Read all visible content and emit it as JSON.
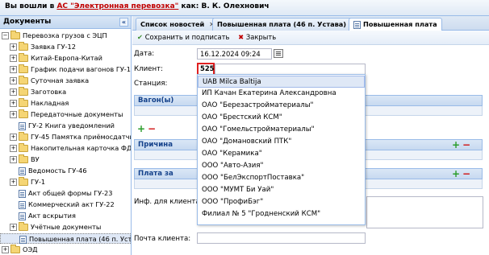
{
  "header": {
    "logged_prefix": "Вы вошли в",
    "system_name": "АС \"Электронная перевозка\"",
    "as_text": "как: В. К. Олехнович"
  },
  "sidebar": {
    "title": "Документы",
    "collapse": "«",
    "items": [
      {
        "label": "Перевозка грузов с ЭЦП"
      },
      {
        "label": "Заявка ГУ-12"
      },
      {
        "label": "Китай-Европа-Китай"
      },
      {
        "label": "График подачи вагонов ГУ-11"
      },
      {
        "label": "Суточная заявка"
      },
      {
        "label": "Заготовка"
      },
      {
        "label": "Накладная"
      },
      {
        "label": "Передаточные документы"
      },
      {
        "label": "ГУ-2 Книга уведомлений"
      },
      {
        "label": "ГУ-45 Памятка приёмосдатчика"
      },
      {
        "label": "Накопительная карточка ФДУ-92"
      },
      {
        "label": "ВУ"
      },
      {
        "label": "Ведомость ГУ-46"
      },
      {
        "label": "ГУ-1"
      },
      {
        "label": "Акт общей формы ГУ-23"
      },
      {
        "label": "Коммерческий акт ГУ-22"
      },
      {
        "label": "Акт вскрытия"
      },
      {
        "label": "Учётные документы"
      },
      {
        "label": "Повышенная плата (46 п. Устава)"
      },
      {
        "label": "ОЭД"
      }
    ]
  },
  "tabs": [
    {
      "label": "Список новостей"
    },
    {
      "label": "Повышенная плата (46 п. Устава)"
    },
    {
      "label": "Повышенная плата"
    }
  ],
  "toolbar": {
    "save_sign": "Сохранить и подписать",
    "close": "Закрыть"
  },
  "form": {
    "date_label": "Дата:",
    "date_value": "16.12.2024 09:24",
    "client_label": "Клиент:",
    "client_value": "525",
    "station_label": "Станция:",
    "wagons_section": "Вагон(ы)",
    "reason_section": "Причина",
    "pay_section": "Плата за",
    "info_label": "Инф. для клиента:",
    "email_label": "Почта клиента:"
  },
  "dropdown": {
    "options": [
      "UAB Milca Baltija",
      "ИП Качан Екатерина Александровна",
      "ОАО \"Березастройматериалы\"",
      "ОАО \"Брестский КСМ\"",
      "ОАО \"Гомельстройматериалы\"",
      "ОАО \"Домановский ПТК\"",
      "ОАО \"Керамика\"",
      "ООО \"Авто-Азия\"",
      "ООО \"БелЭкспортПоставка\"",
      "ООО \"МУМТ Би Уай\"",
      "ООО \"ПрофиБэг\"",
      "Филиал № 5 \"Гродненский КСМ\""
    ]
  }
}
